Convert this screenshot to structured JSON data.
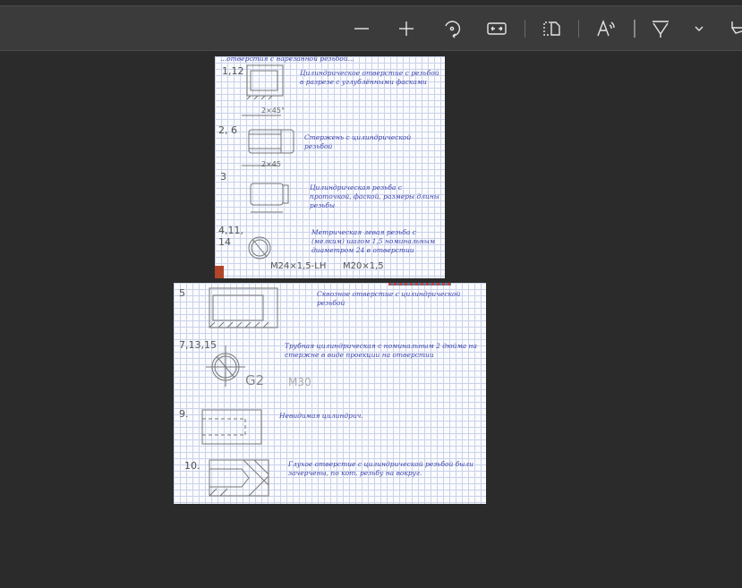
{
  "toolbar": {
    "buttons": [
      {
        "name": "zoom-out",
        "icon": "minus-icon"
      },
      {
        "name": "zoom-in",
        "icon": "plus-icon"
      },
      {
        "name": "rotate",
        "icon": "rotate-icon"
      },
      {
        "name": "fit-to-width",
        "icon": "fit-width-icon"
      },
      {
        "name": "page-view",
        "icon": "two-page-icon"
      },
      {
        "name": "read-aloud",
        "icon": "read-aloud-icon"
      },
      {
        "name": "highlight",
        "icon": "highlighter-icon"
      },
      {
        "name": "highlight-options",
        "icon": "chevron-down-icon"
      },
      {
        "name": "draw",
        "icon": "draw-icon"
      }
    ]
  },
  "page1": {
    "header": "...отверстия с нарезанной резьбой...",
    "items": [
      {
        "num": "1,12",
        "text": "Цилиндрическое отверстие с резьбой в разрезе с углублёнными фасками",
        "dim": "2×45°"
      },
      {
        "num": "2, 6",
        "text": "Стержень с цилиндрической резьбой",
        "dim": "2×45"
      },
      {
        "num": "3",
        "text": "Цилиндрическая резьба с проточкой, фаской, размеры длины резьбы"
      },
      {
        "num": "4,11, 14",
        "text": "Метрическая левая резьба с (мелким) шагом 1,5 номинальным диаметром 24 в отверстии"
      }
    ],
    "designation": "M24×1,5-LH",
    "designation_alt": "M20×1,5"
  },
  "page2": {
    "items": [
      {
        "num": "5",
        "text": "Сквозное отверстие с цилиндрической резьбой"
      },
      {
        "num": "7,13,15",
        "text": "Трубная цилиндрическая с номинальным 2 дюйма на стержне в виде проекции на отверстии"
      },
      {
        "num": "9.",
        "text": "Невидимая цилиндрич."
      },
      {
        "num": "10.",
        "text": "Глухое отверстие с цилиндрической резьбой были зачерчены, по кот. резьбу на вокруг."
      }
    ],
    "g_label": "G2",
    "m_label": "M30"
  }
}
